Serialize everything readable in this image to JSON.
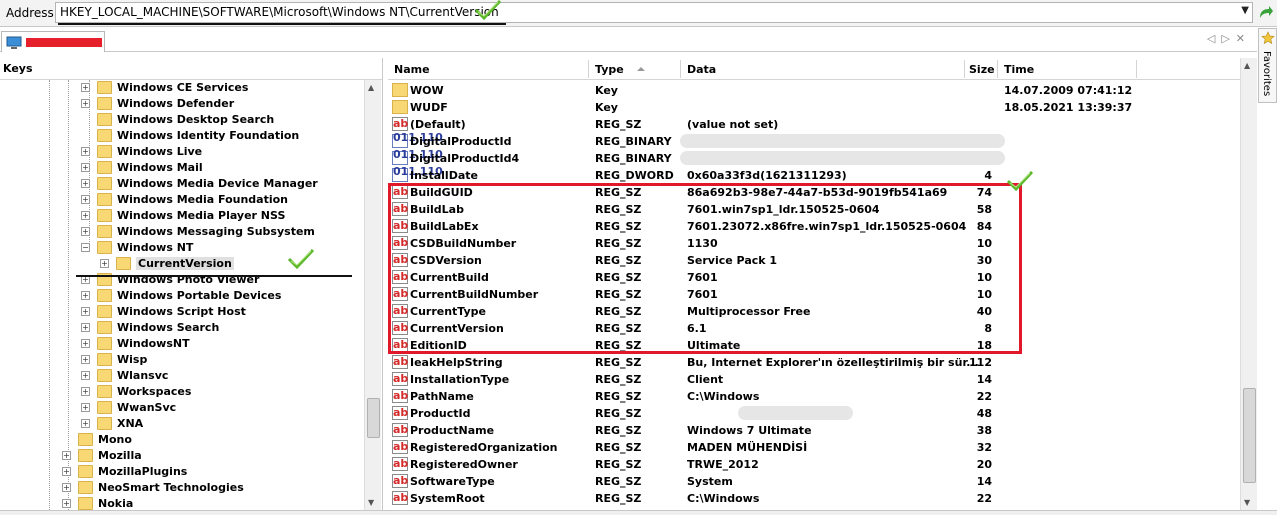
{
  "address": {
    "label": "Address",
    "value": "HKEY_LOCAL_MACHINE\\SOFTWARE\\Microsoft\\Windows NT\\CurrentVersion"
  },
  "tab": {
    "title_redacted": true
  },
  "favorites": {
    "label": "Favorites"
  },
  "keys": {
    "header": "Keys",
    "items": [
      {
        "label": "Windows CE Services",
        "level": 2,
        "expandable": true
      },
      {
        "label": "Windows Defender",
        "level": 2,
        "expandable": true
      },
      {
        "label": "Windows Desktop Search",
        "level": 2,
        "expandable": false
      },
      {
        "label": "Windows Identity Foundation",
        "level": 2,
        "expandable": false
      },
      {
        "label": "Windows Live",
        "level": 2,
        "expandable": true
      },
      {
        "label": "Windows Mail",
        "level": 2,
        "expandable": true
      },
      {
        "label": "Windows Media Device Manager",
        "level": 2,
        "expandable": true
      },
      {
        "label": "Windows Media Foundation",
        "level": 2,
        "expandable": true
      },
      {
        "label": "Windows Media Player NSS",
        "level": 2,
        "expandable": true
      },
      {
        "label": "Windows Messaging Subsystem",
        "level": 2,
        "expandable": true
      },
      {
        "label": "Windows NT",
        "level": 2,
        "expandable": true,
        "expanded": true
      },
      {
        "label": "CurrentVersion",
        "level": 3,
        "expandable": true,
        "selected": true
      },
      {
        "label": "Windows Photo Viewer",
        "level": 2,
        "expandable": true
      },
      {
        "label": "Windows Portable Devices",
        "level": 2,
        "expandable": true
      },
      {
        "label": "Windows Script Host",
        "level": 2,
        "expandable": true
      },
      {
        "label": "Windows Search",
        "level": 2,
        "expandable": true
      },
      {
        "label": "WindowsNT",
        "level": 2,
        "expandable": true
      },
      {
        "label": "Wisp",
        "level": 2,
        "expandable": true
      },
      {
        "label": "Wlansvc",
        "level": 2,
        "expandable": true
      },
      {
        "label": "Workspaces",
        "level": 2,
        "expandable": true
      },
      {
        "label": "WwanSvc",
        "level": 2,
        "expandable": true
      },
      {
        "label": "XNA",
        "level": 2,
        "expandable": true
      },
      {
        "label": "Mono",
        "level": 1,
        "expandable": false
      },
      {
        "label": "Mozilla",
        "level": 1,
        "expandable": true
      },
      {
        "label": "MozillaPlugins",
        "level": 1,
        "expandable": true
      },
      {
        "label": "NeoSmart Technologies",
        "level": 1,
        "expandable": true
      },
      {
        "label": "Nokia",
        "level": 1,
        "expandable": true
      }
    ]
  },
  "values": {
    "columns": {
      "name": "Name",
      "type": "Type",
      "data": "Data",
      "size": "Size",
      "time": "Time"
    },
    "rows": [
      {
        "icon": "key",
        "name": "WOW",
        "type": "Key",
        "data": "",
        "size": "",
        "time": "14.07.2009 07:41:12"
      },
      {
        "icon": "key",
        "name": "WUDF",
        "type": "Key",
        "data": "",
        "size": "",
        "time": "18.05.2021 13:39:37"
      },
      {
        "icon": "string",
        "name": "(Default)",
        "type": "REG_SZ",
        "data": "(value not set)",
        "size": "",
        "time": ""
      },
      {
        "icon": "binary",
        "name": "DigitalProductId",
        "type": "REG_BINARY",
        "data": "",
        "size": "",
        "time": "",
        "redacted": true
      },
      {
        "icon": "binary",
        "name": "DigitalProductId4",
        "type": "REG_BINARY",
        "data": "",
        "size": "",
        "time": "",
        "redacted": true
      },
      {
        "icon": "binary",
        "name": "InstallDate",
        "type": "REG_DWORD",
        "data": "0x60a33f3d(1621311293)",
        "size": "4",
        "time": ""
      },
      {
        "icon": "string",
        "name": "BuildGUID",
        "type": "REG_SZ",
        "data": "86a692b3-98e7-44a7-b53d-9019fb541a69",
        "size": "74",
        "time": ""
      },
      {
        "icon": "string",
        "name": "BuildLab",
        "type": "REG_SZ",
        "data": "7601.win7sp1_ldr.150525-0604",
        "size": "58",
        "time": ""
      },
      {
        "icon": "string",
        "name": "BuildLabEx",
        "type": "REG_SZ",
        "data": "7601.23072.x86fre.win7sp1_ldr.150525-0604",
        "size": "84",
        "time": ""
      },
      {
        "icon": "string",
        "name": "CSDBuildNumber",
        "type": "REG_SZ",
        "data": "1130",
        "size": "10",
        "time": ""
      },
      {
        "icon": "string",
        "name": "CSDVersion",
        "type": "REG_SZ",
        "data": "Service Pack 1",
        "size": "30",
        "time": ""
      },
      {
        "icon": "string",
        "name": "CurrentBuild",
        "type": "REG_SZ",
        "data": "7601",
        "size": "10",
        "time": ""
      },
      {
        "icon": "string",
        "name": "CurrentBuildNumber",
        "type": "REG_SZ",
        "data": "7601",
        "size": "10",
        "time": ""
      },
      {
        "icon": "string",
        "name": "CurrentType",
        "type": "REG_SZ",
        "data": "Multiprocessor Free",
        "size": "40",
        "time": ""
      },
      {
        "icon": "string",
        "name": "CurrentVersion",
        "type": "REG_SZ",
        "data": "6.1",
        "size": "8",
        "time": ""
      },
      {
        "icon": "string",
        "name": "EditionID",
        "type": "REG_SZ",
        "data": "Ultimate",
        "size": "18",
        "time": ""
      },
      {
        "icon": "string",
        "name": "IeakHelpString",
        "type": "REG_SZ",
        "data": "Bu, Internet Explorer'ın özelleştirilmiş bir sür...",
        "size": "112",
        "time": ""
      },
      {
        "icon": "string",
        "name": "InstallationType",
        "type": "REG_SZ",
        "data": "Client",
        "size": "14",
        "time": ""
      },
      {
        "icon": "string",
        "name": "PathName",
        "type": "REG_SZ",
        "data": "C:\\Windows",
        "size": "22",
        "time": ""
      },
      {
        "icon": "string",
        "name": "ProductId",
        "type": "REG_SZ",
        "data": "",
        "size": "48",
        "time": "",
        "redacted": true
      },
      {
        "icon": "string",
        "name": "ProductName",
        "type": "REG_SZ",
        "data": "Windows 7 Ultimate",
        "size": "38",
        "time": ""
      },
      {
        "icon": "string",
        "name": "RegisteredOrganization",
        "type": "REG_SZ",
        "data": "MADEN MÜHENDİSİ",
        "size": "32",
        "time": ""
      },
      {
        "icon": "string",
        "name": "RegisteredOwner",
        "type": "REG_SZ",
        "data": "TRWE_2012",
        "size": "20",
        "time": ""
      },
      {
        "icon": "string",
        "name": "SoftwareType",
        "type": "REG_SZ",
        "data": "System",
        "size": "14",
        "time": ""
      },
      {
        "icon": "string",
        "name": "SystemRoot",
        "type": "REG_SZ",
        "data": "C:\\Windows",
        "size": "22",
        "time": ""
      }
    ]
  },
  "colors": {
    "highlight_box": "#e0182a",
    "checkmark": "#5cb82a",
    "folder": "#f8d775"
  }
}
